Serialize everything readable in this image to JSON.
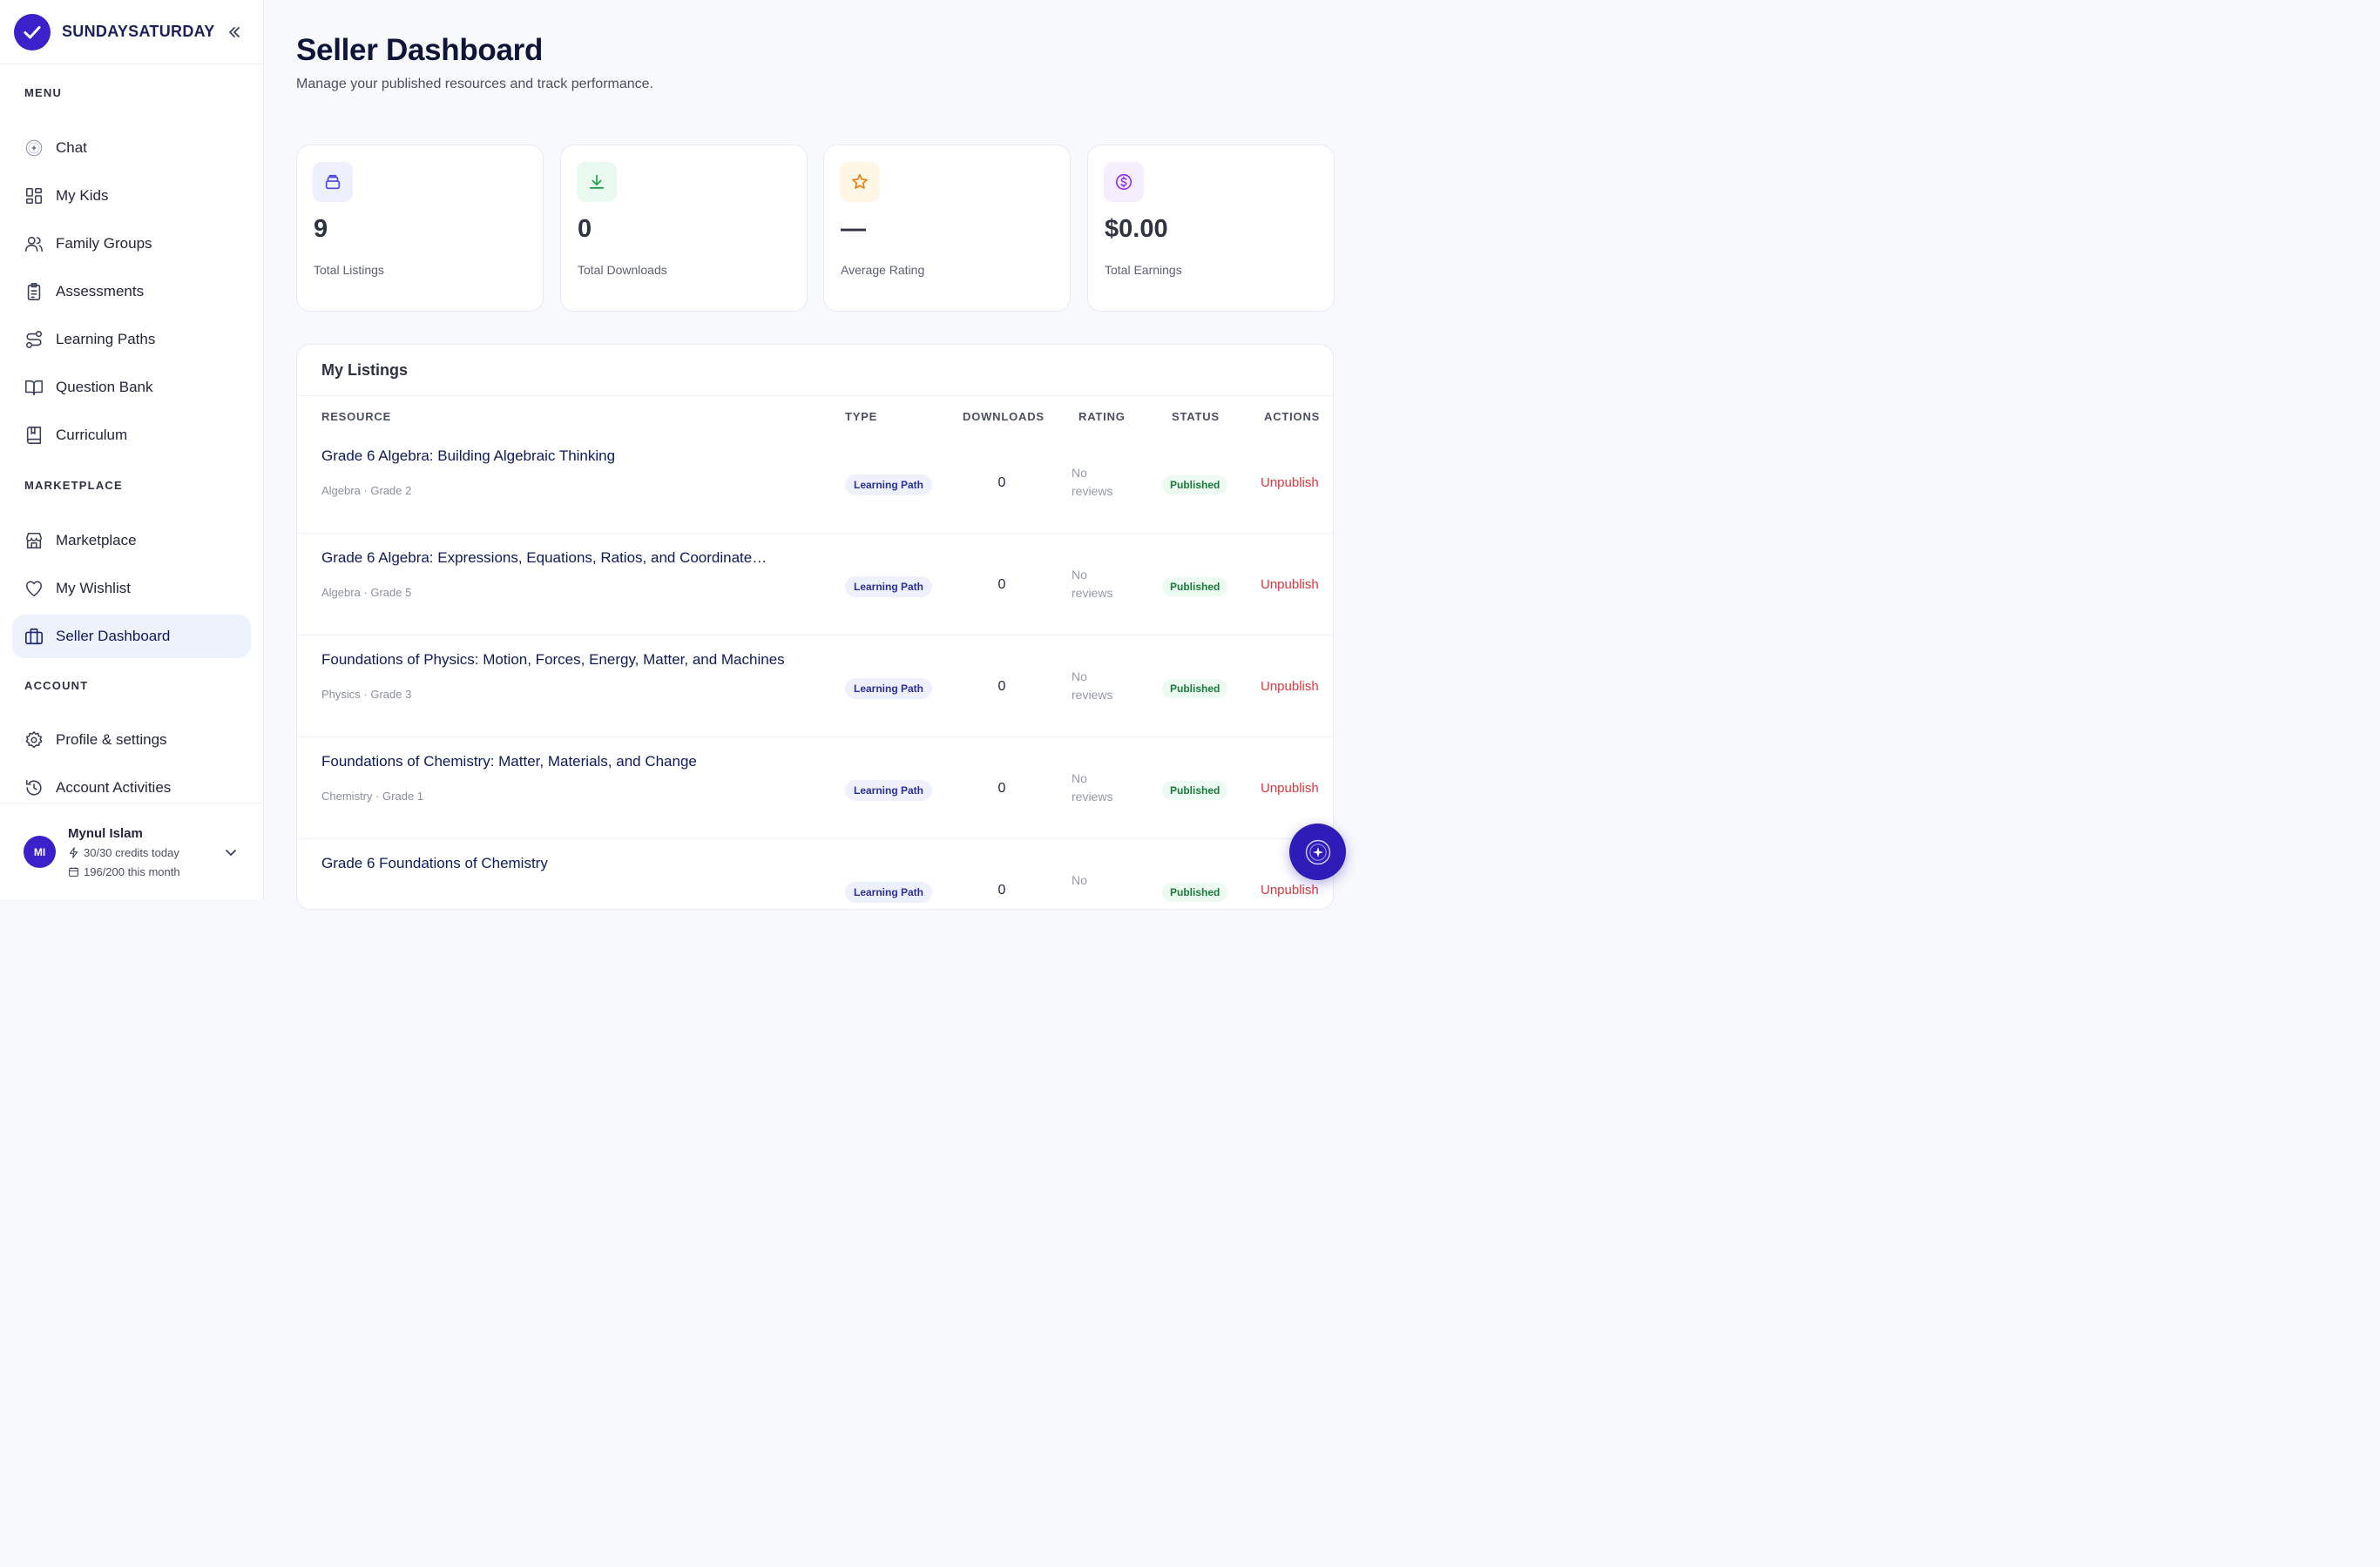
{
  "brand": {
    "name": "SUNDAYSATURDAY"
  },
  "sidebar": {
    "sections": {
      "menu": "MENU",
      "marketplace": "MARKETPLACE",
      "account": "ACCOUNT"
    },
    "items": [
      {
        "label": "Chat",
        "icon": "sparkle-circle-icon"
      },
      {
        "label": "My Kids",
        "icon": "grid-icon"
      },
      {
        "label": "Family Groups",
        "icon": "users-icon"
      },
      {
        "label": "Assessments",
        "icon": "clipboard-icon"
      },
      {
        "label": "Learning Paths",
        "icon": "route-icon"
      },
      {
        "label": "Question Bank",
        "icon": "book-open-icon"
      },
      {
        "label": "Curriculum",
        "icon": "notebook-icon"
      },
      {
        "label": "Marketplace",
        "icon": "store-icon"
      },
      {
        "label": "My Wishlist",
        "icon": "heart-icon"
      },
      {
        "label": "Seller Dashboard",
        "icon": "briefcase-icon",
        "active": true
      },
      {
        "label": "Profile & settings",
        "icon": "gear-icon"
      },
      {
        "label": "Account Activities",
        "icon": "history-icon"
      }
    ]
  },
  "user": {
    "initials": "MI",
    "name": "Mynul Islam",
    "credits_today": "30/30 credits today",
    "credits_month": "196/200 this month"
  },
  "header": {
    "title": "Seller Dashboard",
    "subtitle": "Manage your published resources and track performance."
  },
  "stats": [
    {
      "value": "9",
      "label": "Total Listings",
      "icon": "stack-icon",
      "color": "#4f46e5",
      "bg": "#eef0fd"
    },
    {
      "value": "0",
      "label": "Total Downloads",
      "icon": "download-icon",
      "color": "#16a34a",
      "bg": "#eafaf0"
    },
    {
      "value": "—",
      "label": "Average Rating",
      "icon": "star-icon",
      "color": "#ea7a12",
      "bg": "#fff6e6"
    },
    {
      "value": "$0.00",
      "label": "Total Earnings",
      "icon": "dollar-circle-icon",
      "color": "#9333ea",
      "bg": "#f5eefe"
    }
  ],
  "listings": {
    "title": "My Listings",
    "columns": {
      "resource": "RESOURCE",
      "type": "TYPE",
      "downloads": "DOWNLOADS",
      "rating": "RATING",
      "status": "STATUS",
      "actions": "ACTIONS"
    },
    "rows": [
      {
        "title": "Grade 6 Algebra: Building Algebraic Thinking",
        "meta": "Algebra · Grade 2",
        "type": "Learning Path",
        "downloads": "0",
        "rating": "No reviews",
        "status": "Published",
        "action": "Unpublish"
      },
      {
        "title": "Grade 6 Algebra: Expressions, Equations, Ratios, and Coordinate…",
        "meta": "Algebra · Grade 5",
        "type": "Learning Path",
        "downloads": "0",
        "rating": "No reviews",
        "status": "Published",
        "action": "Unpublish"
      },
      {
        "title": "Foundations of Physics: Motion, Forces, Energy, Matter, and Machines",
        "meta": "Physics · Grade 3",
        "type": "Learning Path",
        "downloads": "0",
        "rating": "No reviews",
        "status": "Published",
        "action": "Unpublish"
      },
      {
        "title": "Foundations of Chemistry: Matter, Materials, and Change",
        "meta": "Chemistry · Grade 1",
        "type": "Learning Path",
        "downloads": "0",
        "rating": "No reviews",
        "status": "Published",
        "action": "Unpublish"
      },
      {
        "title": "Grade 6 Foundations of Chemistry",
        "meta": "",
        "type": "Learning Path",
        "downloads": "0",
        "rating": "No",
        "status": "Published",
        "action": "Unpublish"
      }
    ]
  },
  "fab": {
    "icon": "sparkle-circle-icon"
  }
}
